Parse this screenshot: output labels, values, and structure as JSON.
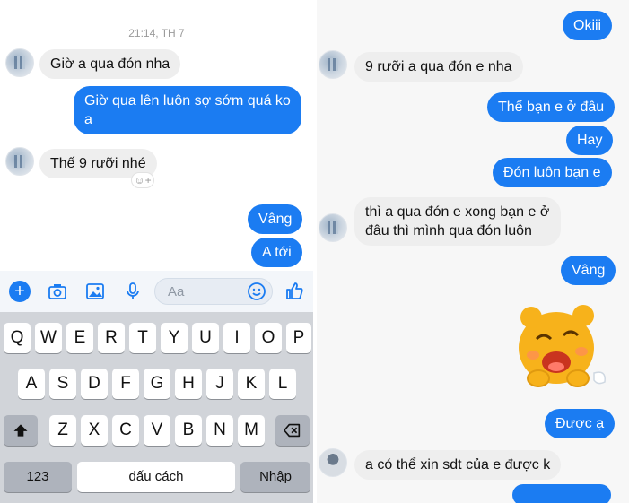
{
  "left_panel": {
    "timestamp": "21:14, TH 7",
    "messages": [
      {
        "side": "in",
        "text": "Giờ a qua đón nha"
      },
      {
        "side": "out",
        "text": "Giờ qua lên luôn sợ sớm quá ko a"
      },
      {
        "side": "in",
        "text": "Thế 9 rưỡi nhé"
      },
      {
        "side": "out",
        "text": "Vâng"
      },
      {
        "side": "out",
        "text": "A tới"
      }
    ],
    "composer": {
      "placeholder": "Aa",
      "icons": [
        "plus-icon",
        "camera-icon",
        "image-icon",
        "microphone-icon",
        "emoji-icon",
        "thumbs-up-icon"
      ]
    },
    "keyboard": {
      "row1": [
        "Q",
        "W",
        "E",
        "R",
        "T",
        "Y",
        "U",
        "I",
        "O",
        "P"
      ],
      "row2": [
        "A",
        "S",
        "D",
        "F",
        "G",
        "H",
        "J",
        "K",
        "L"
      ],
      "row3": [
        "Z",
        "X",
        "C",
        "V",
        "B",
        "N",
        "M"
      ],
      "shift_icon": "shift-icon",
      "backspace_icon": "backspace-icon",
      "numbers_label": "123",
      "space_label": "dấu cách",
      "return_label": "Nhập"
    }
  },
  "right_panel": {
    "messages": [
      {
        "side": "out",
        "text": "Okiii"
      },
      {
        "side": "in",
        "text": "9 rưỡi a qua đón e nha"
      },
      {
        "side": "out",
        "text": "Thế bạn e ở đâu"
      },
      {
        "side": "out",
        "text": "Hay"
      },
      {
        "side": "out",
        "text": "Đón luôn bạn e"
      },
      {
        "side": "in",
        "text": "thì a qua đón e xong bạn e ở đâu thì mình qua đón luôn"
      },
      {
        "side": "out",
        "text": "Vâng"
      },
      {
        "side": "out",
        "text": "Được ạ"
      },
      {
        "side": "in",
        "text": "a có thể xin sdt của e được k"
      }
    ],
    "sticker": "yellow-blob-sticker"
  },
  "colors": {
    "outgoing_bubble": "#1b7cf2",
    "incoming_bubble": "#eeeeee",
    "keyboard_bg": "#d1d4d9"
  }
}
